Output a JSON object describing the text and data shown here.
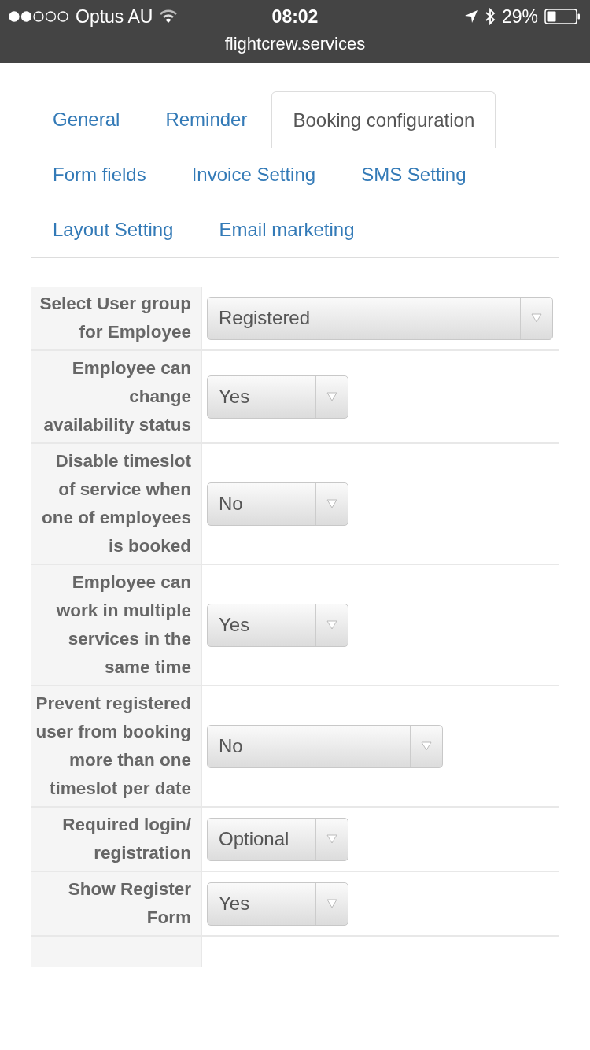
{
  "status_bar": {
    "carrier": "Optus AU",
    "time": "08:02",
    "battery": "29%"
  },
  "address_bar": {
    "url": "flightcrew.services"
  },
  "tabs": [
    {
      "label": "General",
      "selected": false
    },
    {
      "label": "Reminder",
      "selected": false
    },
    {
      "label": "Booking configuration",
      "selected": true
    },
    {
      "label": "Form fields",
      "selected": false
    },
    {
      "label": "Invoice Setting",
      "selected": false
    },
    {
      "label": "SMS Setting",
      "selected": false
    },
    {
      "label": "Layout Setting",
      "selected": false
    },
    {
      "label": "Email marketing",
      "selected": false
    }
  ],
  "settings": [
    {
      "label": "Select User group for Employee",
      "value": "Registered",
      "kind": "wide"
    },
    {
      "label": "Employee can change availability status",
      "value": "Yes",
      "kind": "short"
    },
    {
      "label": "Disable timeslot of service when one of employees is booked",
      "value": "No",
      "kind": "short"
    },
    {
      "label": "Employee can work in multiple services in the same time",
      "value": "Yes",
      "kind": "short"
    },
    {
      "label": "Prevent registered user from booking more than one timeslot per date",
      "value": "No",
      "kind": "medium"
    },
    {
      "label": "Required login/ registration",
      "value": "Optional",
      "kind": "short"
    },
    {
      "label": "Show Register Form",
      "value": "Yes",
      "kind": "short"
    }
  ]
}
